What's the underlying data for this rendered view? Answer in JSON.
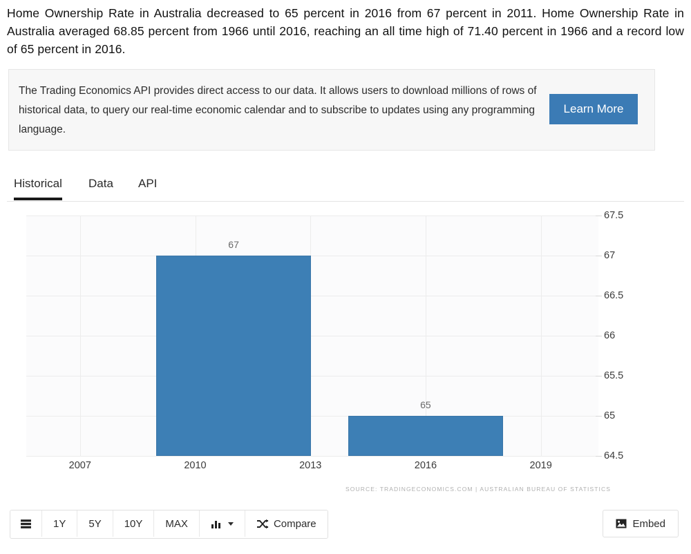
{
  "intro": {
    "paragraph": "Home Ownership Rate in Australia decreased to 65 percent in 2016 from 67 percent in 2011. Home Ownership Rate in Australia averaged 68.85 percent from 1966 until 2016, reaching an all time high of 71.40 percent in 1966 and a record low of 65 percent in 2016."
  },
  "promo": {
    "text": "The Trading Economics API provides direct access to our data. It allows users to download millions of rows of historical data, to query our real-time economic calendar and to subscribe to updates using any programming language.",
    "button_label": "Learn More",
    "button_color": "#3b7bb5"
  },
  "tabs": [
    {
      "label": "Historical",
      "active": true
    },
    {
      "label": "Data",
      "active": false
    },
    {
      "label": "API",
      "active": false
    }
  ],
  "chart_data": {
    "type": "bar",
    "title": "",
    "xlabel": "",
    "ylabel": "",
    "categories": [
      "2011",
      "2016"
    ],
    "values": [
      67,
      65
    ],
    "bar_labels": [
      "67",
      "65"
    ],
    "bar_color": "#3d7fb5",
    "ylim": [
      64.5,
      67.5
    ],
    "y_ticks": [
      "67.5",
      "67",
      "66.5",
      "66",
      "65.5",
      "65",
      "64.5"
    ],
    "y_tick_values": [
      67.5,
      67,
      66.5,
      66,
      65.5,
      65,
      64.5
    ],
    "x_ticks": [
      "2007",
      "2010",
      "2013",
      "2016",
      "2019"
    ],
    "x_tick_values": [
      2007,
      2010,
      2013,
      2016,
      2019
    ],
    "xlim": [
      2005.6,
      2020.5
    ],
    "grid": true,
    "legend": "none",
    "source": "SOURCE: TRADINGECONOMICS.COM | AUSTRALIAN BUREAU OF STATISTICS"
  },
  "toolbar": {
    "buttons": [
      {
        "name": "list-view",
        "label": "",
        "icon": "list-icon"
      },
      {
        "name": "range-1y",
        "label": "1Y",
        "icon": ""
      },
      {
        "name": "range-5y",
        "label": "5Y",
        "icon": ""
      },
      {
        "name": "range-10y",
        "label": "10Y",
        "icon": ""
      },
      {
        "name": "range-max",
        "label": "MAX",
        "icon": ""
      },
      {
        "name": "chart-type",
        "label": "",
        "icon": "bar-chart-icon"
      },
      {
        "name": "compare",
        "label": "Compare",
        "icon": "shuffle-icon"
      }
    ],
    "embed_label": "Embed"
  }
}
